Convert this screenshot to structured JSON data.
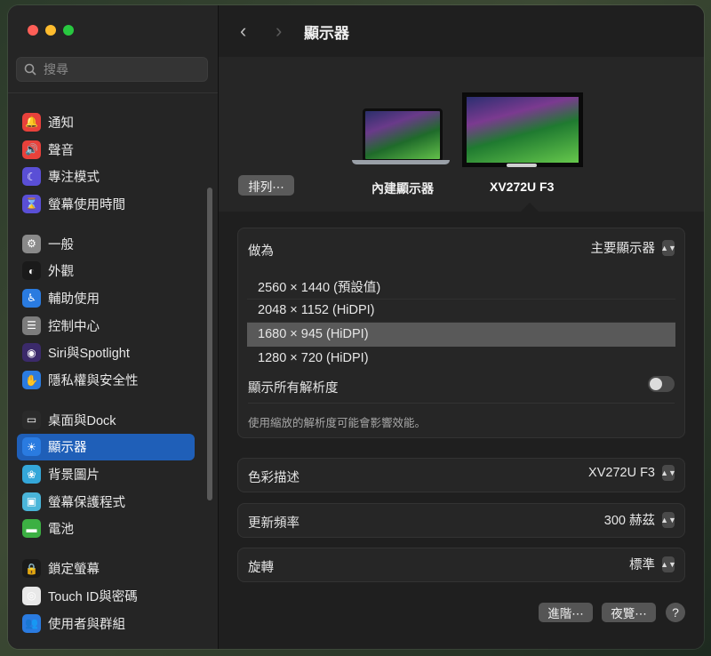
{
  "search": {
    "placeholder": "搜尋"
  },
  "sidebar": {
    "groups": [
      [
        {
          "label": "通知",
          "icon": "bell-icon",
          "color": "#e8413b",
          "glyph": "🔔"
        },
        {
          "label": "聲音",
          "icon": "speaker-icon",
          "color": "#e8413b",
          "glyph": "🔊"
        },
        {
          "label": "專注模式",
          "icon": "moon-icon",
          "color": "#5a4fd6",
          "glyph": "☾"
        },
        {
          "label": "螢幕使用時間",
          "icon": "hourglass-icon",
          "color": "#5a4fd6",
          "glyph": "⌛"
        }
      ],
      [
        {
          "label": "一般",
          "icon": "gear-icon",
          "color": "#8a8a8a",
          "glyph": "⚙"
        },
        {
          "label": "外觀",
          "icon": "appearance-icon",
          "color": "#1a1a1a",
          "glyph": "◐"
        },
        {
          "label": "輔助使用",
          "icon": "accessibility-icon",
          "color": "#2a7be0",
          "glyph": "♿"
        },
        {
          "label": "控制中心",
          "icon": "control-center-icon",
          "color": "#7d7d7d",
          "glyph": "☰"
        },
        {
          "label": "Siri與Spotlight",
          "icon": "siri-icon",
          "color": "#3b2a6a",
          "glyph": "◉"
        },
        {
          "label": "隱私權與安全性",
          "icon": "hand-icon",
          "color": "#2a7be0",
          "glyph": "✋"
        }
      ],
      [
        {
          "label": "桌面與Dock",
          "icon": "dock-icon",
          "color": "#2a2a2a",
          "glyph": "▭"
        },
        {
          "label": "顯示器",
          "icon": "display-icon",
          "color": "#2a7be0",
          "glyph": "☀",
          "active": true
        },
        {
          "label": "背景圖片",
          "icon": "wallpaper-icon",
          "color": "#34a7d9",
          "glyph": "❀"
        },
        {
          "label": "螢幕保護程式",
          "icon": "screensaver-icon",
          "color": "#4ab5d9",
          "glyph": "▣"
        },
        {
          "label": "電池",
          "icon": "battery-icon",
          "color": "#3cb043",
          "glyph": "▬"
        }
      ],
      [
        {
          "label": "鎖定螢幕",
          "icon": "lock-icon",
          "color": "#1a1a1a",
          "glyph": "🔒"
        },
        {
          "label": "Touch ID與密碼",
          "icon": "fingerprint-icon",
          "color": "#e8e8e8",
          "glyph": "◎"
        },
        {
          "label": "使用者與群組",
          "icon": "users-icon",
          "color": "#2a7be0",
          "glyph": "👥"
        }
      ]
    ]
  },
  "header": {
    "title": "顯示器",
    "back": "‹",
    "forward": "›"
  },
  "displays": {
    "arrange_label": "排列⋯",
    "builtin_label": "內建顯示器",
    "external_label": "XV272U F3"
  },
  "settings": {
    "use_as_label": "做為",
    "use_as_value": "主要顯示器",
    "resolutions": [
      {
        "label": "2560 × 1440 (預設值)",
        "selected": false
      },
      {
        "label": "2048 × 1152 (HiDPI)",
        "selected": false
      },
      {
        "label": "1680 × 945 (HiDPI)",
        "selected": true
      },
      {
        "label": "1280 × 720 (HiDPI)",
        "selected": false
      }
    ],
    "show_all_label": "顯示所有解析度",
    "show_all_on": false,
    "note": "使用縮放的解析度可能會影響效能。",
    "color_profile_label": "色彩描述",
    "color_profile_value": "XV272U F3",
    "refresh_label": "更新頻率",
    "refresh_value": "300 赫茲",
    "rotation_label": "旋轉",
    "rotation_value": "標準"
  },
  "footer": {
    "advanced": "進階⋯",
    "night_shift": "夜覽⋯",
    "help": "?"
  }
}
